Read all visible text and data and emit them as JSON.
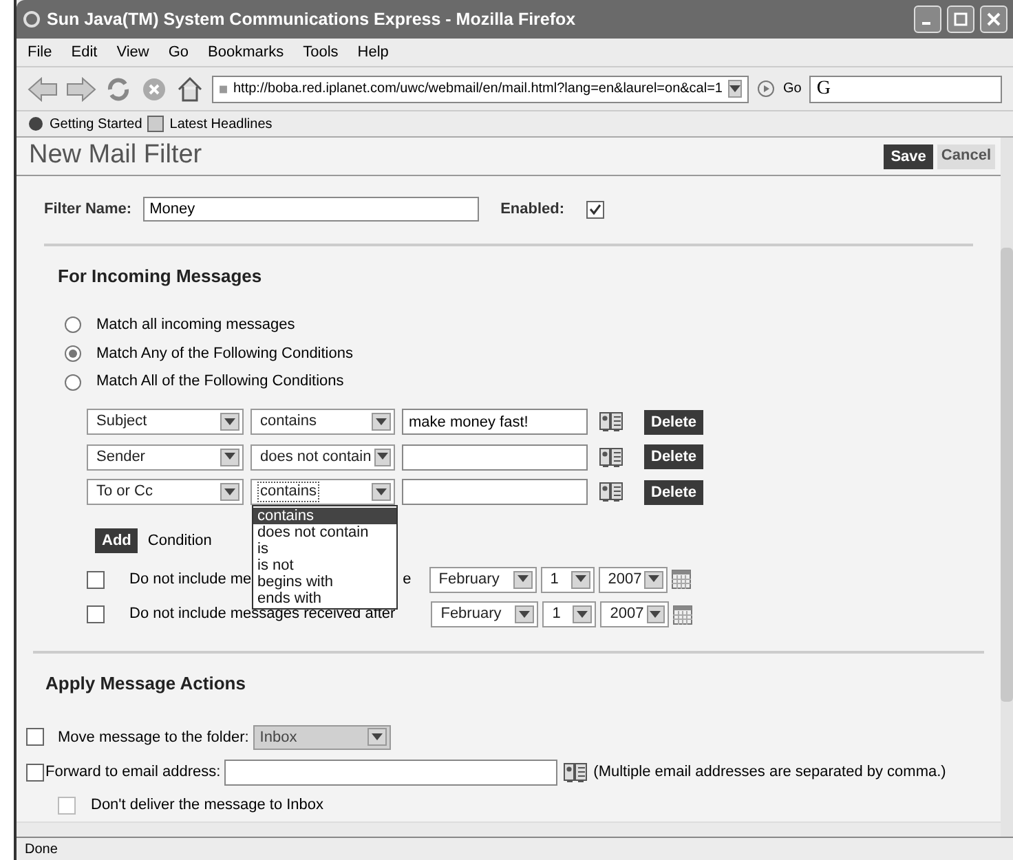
{
  "window": {
    "title": "Sun Java(TM) System Communications Express - Mozilla Firefox"
  },
  "menu": [
    "File",
    "Edit",
    "View",
    "Go",
    "Bookmarks",
    "Tools",
    "Help"
  ],
  "address_bar": {
    "value": "http://boba.red.iplanet.com/uwc/webmail/en/mail.html?lang=en&laurel=on&cal=1",
    "go": "Go",
    "search_glyph": "G"
  },
  "bookmarks": [
    "Getting Started",
    "Latest Headlines"
  ],
  "page": {
    "title": "New Mail Filter",
    "save": "Save",
    "cancel": "Cancel"
  },
  "filter_name": {
    "label": "Filter Name:",
    "value": "Money"
  },
  "enabled": {
    "label": "Enabled:",
    "checked": true
  },
  "incoming": {
    "heading": "For Incoming Messages",
    "match": [
      {
        "label": "Match all incoming messages",
        "selected": false
      },
      {
        "label": "Match Any of the Following Conditions",
        "selected": true
      },
      {
        "label": "Match All of the Following Conditions",
        "selected": false
      }
    ],
    "conditions": [
      {
        "field": "Subject",
        "operator": "contains",
        "value": "make money fast!",
        "delete": "Delete",
        "open": false
      },
      {
        "field": "Sender",
        "operator": "does not contain",
        "delete": "Delete",
        "open": false
      },
      {
        "field": "To or Cc",
        "operator": "contains",
        "delete": "Delete",
        "open": true
      }
    ],
    "operator_options": [
      {
        "label": "contains",
        "selected": true
      },
      {
        "label": "does not contain",
        "selected": false
      },
      {
        "label": "is",
        "selected": false
      },
      {
        "label": "is not",
        "selected": false
      },
      {
        "label": "begins with",
        "selected": false
      },
      {
        "label": "ends with",
        "selected": false
      }
    ],
    "add": {
      "button": "Add",
      "label": "Condition"
    },
    "date_rules": [
      {
        "label": "Do not include me",
        "label_tail": "e",
        "checked": false,
        "month": "February",
        "day": "1",
        "year": "2007"
      },
      {
        "label": "Do not include messages received after",
        "checked": false,
        "month": "February",
        "day": "1",
        "year": "2007"
      }
    ]
  },
  "actions": {
    "heading": "Apply Message Actions",
    "move": {
      "label": "Move message to the folder:",
      "checked": false,
      "folder": "Inbox"
    },
    "forward": {
      "label": "Forward to email address:",
      "checked": false,
      "note": "(Multiple email addresses are separated by comma.)"
    },
    "dont_deliver": {
      "label": "Don't deliver the message to Inbox",
      "checked": false
    }
  },
  "status_bar": "Done"
}
